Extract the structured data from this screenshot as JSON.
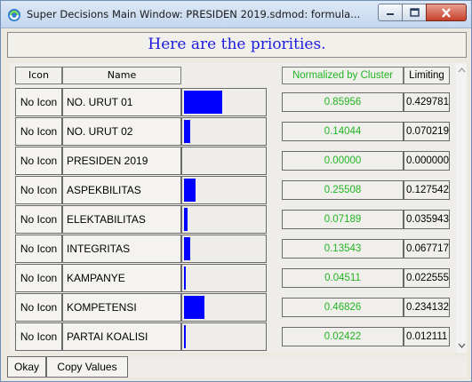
{
  "window": {
    "title": "Super Decisions Main Window: PRESIDEN 2019.sdmod: formula...",
    "icon": "super-decisions-app-icon",
    "controls": [
      "minimize-icon",
      "maximize-icon",
      "close-icon"
    ]
  },
  "banner": {
    "text": "Here are the priorities."
  },
  "table": {
    "headers": {
      "icon": "Icon",
      "name": "Name",
      "normalized": "Normalized by Cluster",
      "limiting": "Limiting"
    },
    "rows": [
      {
        "icon": "No Icon",
        "name": "NO. URUT 01",
        "normalized": "0.85956",
        "limiting": "0.429781",
        "bar_fraction": 0.85956
      },
      {
        "icon": "No Icon",
        "name": "NO. URUT 02",
        "normalized": "0.14044",
        "limiting": "0.070219",
        "bar_fraction": 0.14044
      },
      {
        "icon": "No Icon",
        "name": "PRESIDEN 2019",
        "normalized": "0.00000",
        "limiting": "0.000000",
        "bar_fraction": 0.0
      },
      {
        "icon": "No Icon",
        "name": "ASPEKBILITAS",
        "normalized": "0.25508",
        "limiting": "0.127542",
        "bar_fraction": 0.25508
      },
      {
        "icon": "No Icon",
        "name": "ELEKTABILITAS",
        "normalized": "0.07189",
        "limiting": "0.035943",
        "bar_fraction": 0.07189
      },
      {
        "icon": "No Icon",
        "name": "INTEGRITAS",
        "normalized": "0.13543",
        "limiting": "0.067717",
        "bar_fraction": 0.13543
      },
      {
        "icon": "No Icon",
        "name": "KAMPANYE",
        "normalized": "0.04511",
        "limiting": "0.022555",
        "bar_fraction": 0.04511
      },
      {
        "icon": "No Icon",
        "name": "KOMPETENSI",
        "normalized": "0.46826",
        "limiting": "0.234132",
        "bar_fraction": 0.46826
      },
      {
        "icon": "No Icon",
        "name": "PARTAI KOALISI",
        "normalized": "0.02422",
        "limiting": "0.012111",
        "bar_fraction": 0.02422
      }
    ]
  },
  "buttons": {
    "okay": "Okay",
    "copy_values": "Copy Values"
  },
  "colors": {
    "bar": "#0000ff",
    "normalized_text": "#22b422",
    "banner_text": "#1c1ce0"
  }
}
